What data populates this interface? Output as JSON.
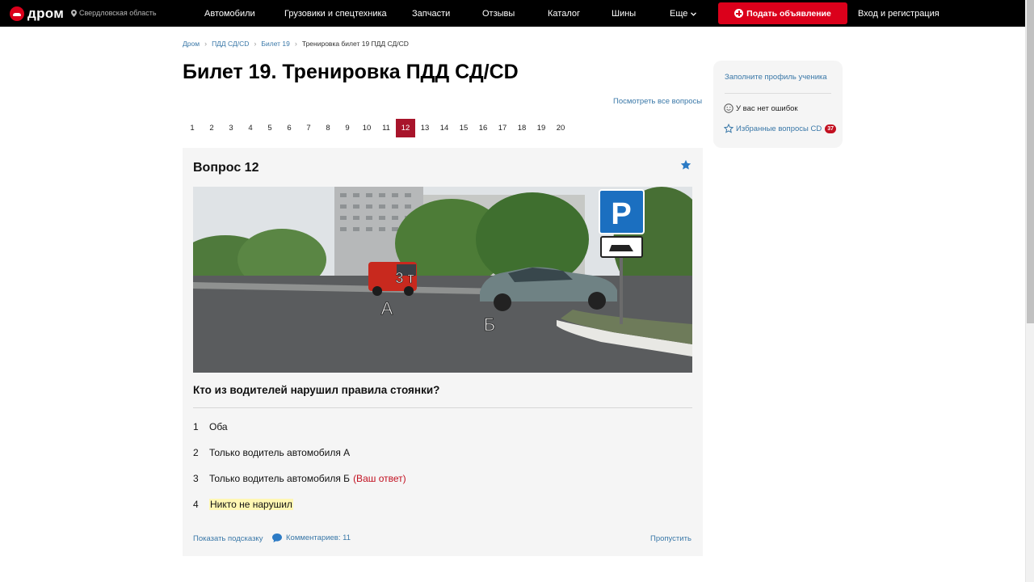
{
  "header": {
    "logo_text": "дром",
    "region": "Свердловская область",
    "nav": [
      "Автомобили",
      "Грузовики и спецтехника",
      "Запчасти",
      "Отзывы",
      "Каталог",
      "Шины",
      "Еще"
    ],
    "post_button": "Подать объявление",
    "login": "Вход и регистрация"
  },
  "breadcrumb": [
    "Дром",
    "ПДД СД/CD",
    "Билет 19",
    "Тренировка билет 19 ПДД СД/CD"
  ],
  "page_title": "Билет 19. Тренировка ПДД СД/CD",
  "all_questions_link": "Посмотреть все вопросы",
  "pagination": {
    "pages": [
      "1",
      "2",
      "3",
      "4",
      "5",
      "6",
      "7",
      "8",
      "9",
      "10",
      "11",
      "12",
      "13",
      "14",
      "15",
      "16",
      "17",
      "18",
      "19",
      "20"
    ],
    "active": "12"
  },
  "question": {
    "title": "Вопрос 12",
    "image_labels": {
      "van_weight": "3 т",
      "car_a": "А",
      "car_b": "Б"
    },
    "text": "Кто из водителей нарушил правила стоянки?",
    "answers": [
      {
        "num": "1",
        "text": "Оба",
        "note": ""
      },
      {
        "num": "2",
        "text": "Только водитель автомобиля А",
        "note": ""
      },
      {
        "num": "3",
        "text": "Только водитель автомобиля Б",
        "note": "(Ваш ответ)"
      },
      {
        "num": "4",
        "text": "Никто не нарушил",
        "note": ""
      }
    ],
    "hint_link": "Показать подсказку",
    "comments_link": "Комментариев: 11",
    "skip_link": "Пропустить"
  },
  "sidebar": {
    "profile_link": "Заполните профиль ученика",
    "no_errors": "У вас нет ошибок",
    "favorites": "Избранные вопросы CD",
    "favorites_count": "37"
  },
  "colors": {
    "accent_red": "#db001b",
    "active_page": "#a8142b",
    "link_blue": "#3a78a8",
    "highlight": "#fff7b3"
  },
  "icons": [
    "pin-icon",
    "chevron-down-icon",
    "plus-circle-icon",
    "star-icon",
    "comment-bubble-icon",
    "smile-icon",
    "star-outline-icon"
  ]
}
